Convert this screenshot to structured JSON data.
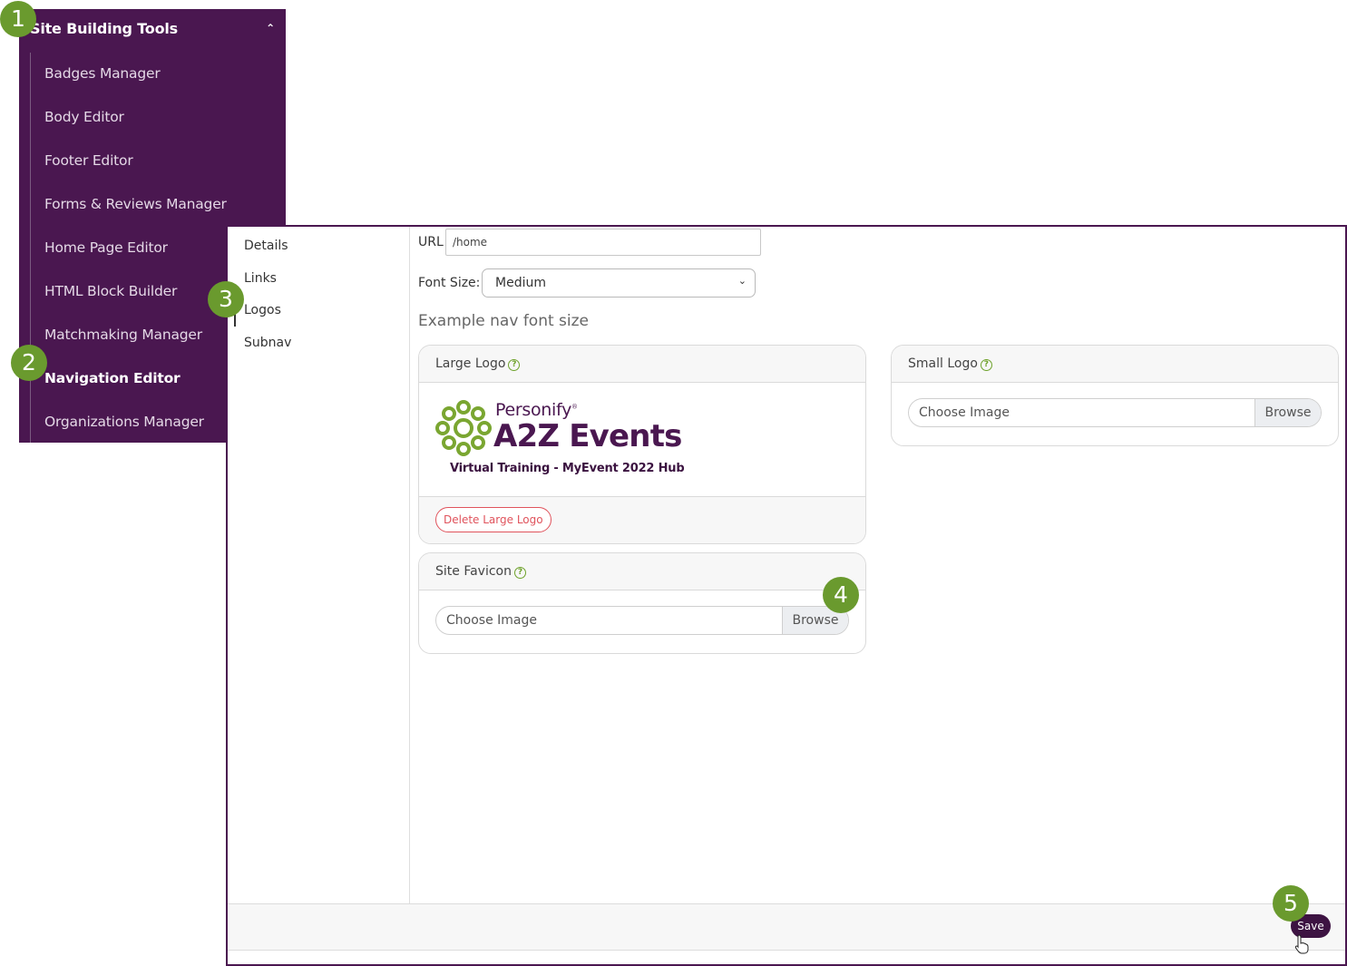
{
  "sidebar": {
    "header": "Site Building Tools",
    "items": [
      {
        "label": "Badges Manager"
      },
      {
        "label": "Body Editor"
      },
      {
        "label": "Footer Editor"
      },
      {
        "label": "Forms & Reviews Manager"
      },
      {
        "label": "Home Page Editor"
      },
      {
        "label": "HTML Block Builder"
      },
      {
        "label": "Matchmaking Manager"
      },
      {
        "label": "Navigation Editor"
      },
      {
        "label": "Organizations Manager"
      }
    ],
    "active_item": "Navigation Editor",
    "color": "#4a1750"
  },
  "panel_nav": {
    "items": [
      "Details",
      "Links",
      "Logos",
      "Subnav"
    ],
    "active": "Logos"
  },
  "form": {
    "url_label": "URL",
    "url_value": "/home",
    "font_size_label": "Font Size:",
    "font_size_value": "Medium",
    "example_text": "Example nav font size"
  },
  "large_logo": {
    "title": "Large Logo",
    "logo_brand": "Personify",
    "logo_brand_mark": "®",
    "logo_main": "A2Z Events",
    "logo_sub": "Virtual Training - MyEvent 2022 Hub",
    "delete_label": "Delete Large Logo"
  },
  "small_logo": {
    "title": "Small Logo",
    "choose_label": "Choose Image",
    "browse_label": "Browse"
  },
  "favicon": {
    "title": "Site Favicon",
    "choose_label": "Choose Image",
    "browse_label": "Browse"
  },
  "footer": {
    "save_label": "Save"
  },
  "badges": [
    "1",
    "2",
    "3",
    "4",
    "5"
  ],
  "colors": {
    "badge_green": "#6a9a2e",
    "delete_red": "#e0535c",
    "help_green": "#6ea22b",
    "save_bg": "#3d1342"
  }
}
